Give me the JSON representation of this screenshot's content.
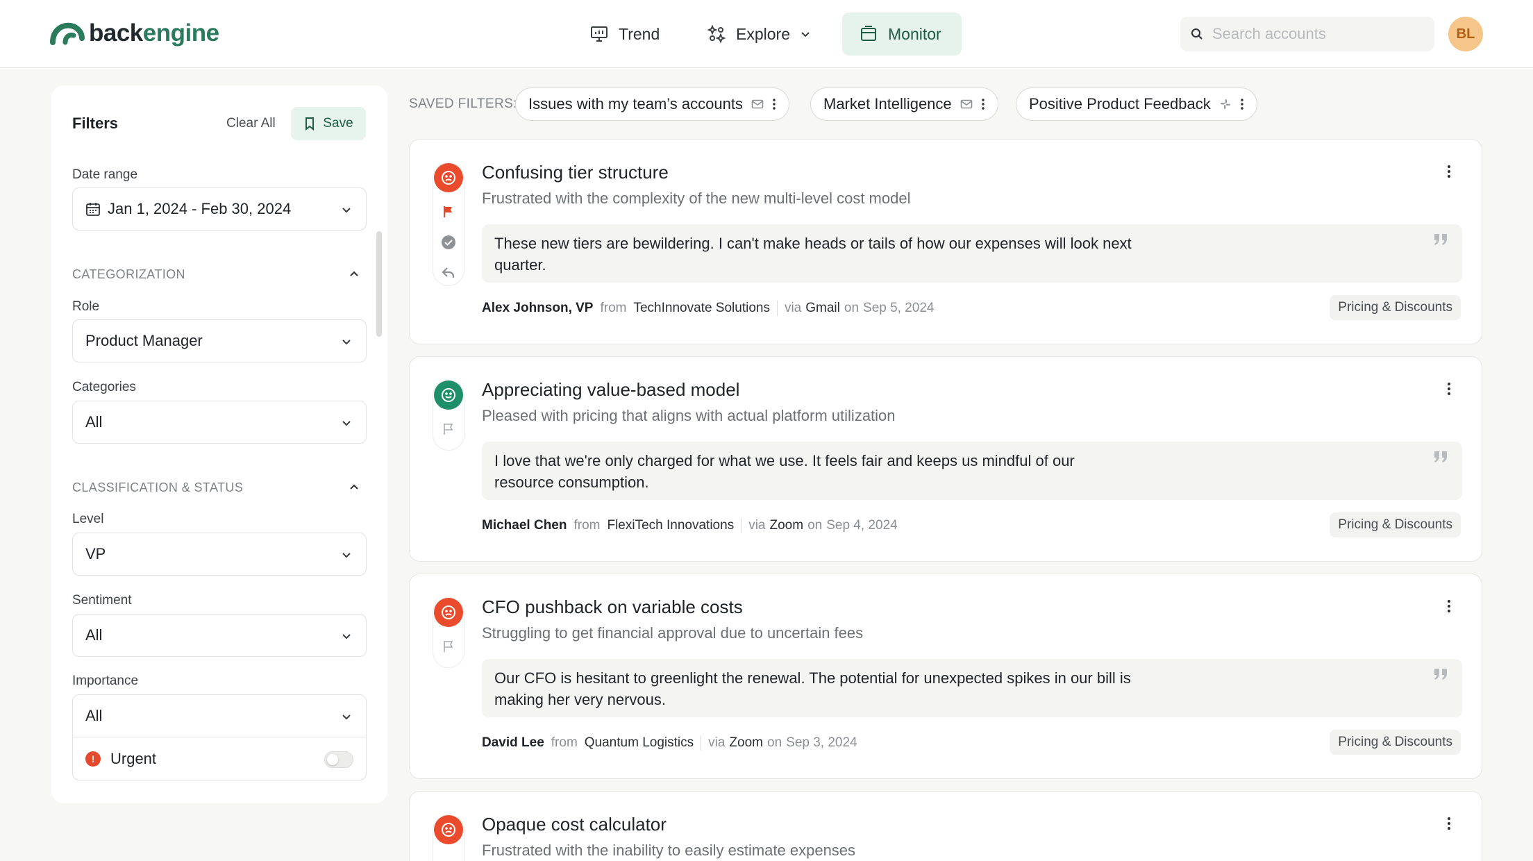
{
  "app": {
    "logo_text_a": "back",
    "logo_text_b": "engine"
  },
  "nav": [
    {
      "label": "Trend",
      "icon": "presentation-chart-icon"
    },
    {
      "label": "Explore",
      "icon": "sparkle-grid-icon"
    },
    {
      "label": "Monitor",
      "icon": "inbox-icon",
      "active": true
    }
  ],
  "search": {
    "placeholder": "Search accounts"
  },
  "user": {
    "initials": "BL"
  },
  "filters": {
    "title": "Filters",
    "clear_label": "Clear All",
    "save_label": "Save",
    "date_range_label": "Date range",
    "date_range_value": "Jan 1, 2024 - Feb 30, 2024",
    "categorization_heading": "CATEGORIZATION",
    "role_label": "Role",
    "role_value": "Product Manager",
    "categories_label": "Categories",
    "categories_value": "All",
    "classification_heading": "CLASSIFICATION & STATUS",
    "level_label": "Level",
    "level_value": "VP",
    "sentiment_label": "Sentiment",
    "sentiment_value": "All",
    "importance_label": "Importance",
    "importance_value": "All",
    "urgent_label": "Urgent",
    "urgent_on": false
  },
  "saved_filters": {
    "label": "SAVED FILTERS:",
    "chips": [
      {
        "label": "Issues with my team’s accounts",
        "icon": "mail-icon"
      },
      {
        "label": "Market Intelligence",
        "icon": "mail-icon"
      },
      {
        "label": "Positive Product Feedback",
        "icon": "slack-icon"
      }
    ]
  },
  "cards": [
    {
      "sentiment": "negative",
      "flagged": true,
      "title": "Confusing tier structure",
      "subtitle": "Frustrated with the complexity of the new multi-level cost model",
      "quote": "These new tiers are bewildering. I can't make heads or tails of how our expenses will look next quarter.",
      "author": "Alex Johnson, VP",
      "from": "from",
      "company": "TechInnovate Solutions",
      "via": "via",
      "source": "Gmail",
      "on": "on",
      "date": "Sep 5, 2024",
      "tag": "Pricing & Discounts"
    },
    {
      "sentiment": "positive",
      "flagged": false,
      "title": "Appreciating value-based model",
      "subtitle": "Pleased with pricing that aligns with actual platform utilization",
      "quote": "I love that we're only charged for what we use. It feels fair and keeps us mindful of our resource consumption.",
      "author": "Michael Chen",
      "from": "from",
      "company": "FlexiTech Innovations",
      "via": "via",
      "source": "Zoom",
      "on": "on",
      "date": "Sep 4, 2024",
      "tag": "Pricing & Discounts"
    },
    {
      "sentiment": "negative",
      "flagged": false,
      "title": "CFO pushback on variable costs",
      "subtitle": "Struggling to get financial approval due to uncertain fees",
      "quote": "Our CFO is hesitant to greenlight the renewal. The potential for unexpected spikes in our bill is making her very nervous.",
      "author": "David Lee",
      "from": "from",
      "company": "Quantum Logistics",
      "via": "via",
      "source": "Zoom",
      "on": "on",
      "date": "Sep 3, 2024",
      "tag": "Pricing & Discounts"
    },
    {
      "sentiment": "negative",
      "flagged": false,
      "title": "Opaque cost calculator",
      "subtitle": "Frustrated with the inability to easily estimate expenses"
    }
  ]
}
